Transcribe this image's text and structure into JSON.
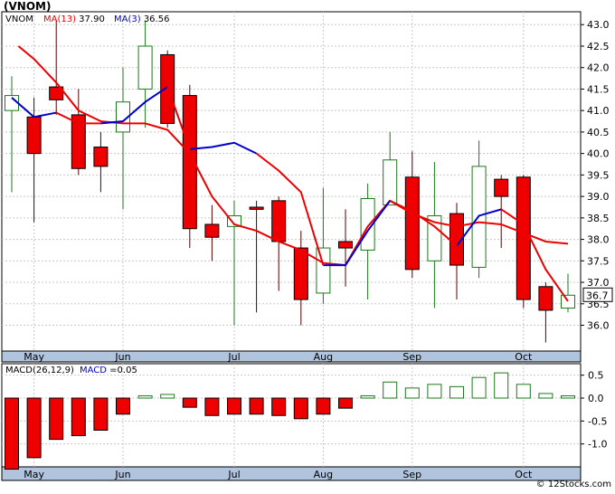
{
  "symbol": "(VNOM)",
  "footer": "© 12Stocks.com",
  "colors": {
    "up": "#1a7a1a",
    "down": "#ee0000",
    "ma13": "#ee0000",
    "ma3": "#0000cc",
    "panel_bg": "#ffffff",
    "axis_band": "#b0c4de",
    "grid": "#c8c8c8"
  },
  "chart_data": [
    {
      "type": "candlestick",
      "legend": [
        {
          "label": "VNOM",
          "value": ""
        },
        {
          "label": "MA(13)",
          "value": "37.90"
        },
        {
          "label": "MA(3)",
          "value": "36.56"
        }
      ],
      "ylim": [
        35.4,
        43.3
      ],
      "y_ticks": [
        36.0,
        36.5,
        37.0,
        37.5,
        38.0,
        38.5,
        39.0,
        39.5,
        40.0,
        40.5,
        41.0,
        41.5,
        42.0,
        42.5,
        43.0
      ],
      "y_tick_labels": [
        "36.0",
        "36.5",
        "37.0",
        "37.5",
        "38.0",
        "38.5",
        "39.0",
        "39.5",
        "40.0",
        "40.5",
        "41.0",
        "41.5",
        "42.0",
        "42.5",
        "43.0"
      ],
      "x_labels": [
        {
          "label": "May",
          "index": 1
        },
        {
          "label": "Jun",
          "index": 5
        },
        {
          "label": "Jul",
          "index": 10
        },
        {
          "label": "Aug",
          "index": 14
        },
        {
          "label": "Sep",
          "index": 18
        },
        {
          "label": "Oct",
          "index": 23
        }
      ],
      "last_price": "36.7",
      "candles": [
        {
          "o": 41.0,
          "h": 41.8,
          "l": 39.1,
          "c": 41.35
        },
        {
          "o": 40.85,
          "h": 41.3,
          "l": 38.4,
          "c": 40.0
        },
        {
          "o": 41.55,
          "h": 43.1,
          "l": 40.9,
          "c": 41.25
        },
        {
          "o": 40.9,
          "h": 41.5,
          "l": 39.5,
          "c": 39.65
        },
        {
          "o": 40.15,
          "h": 40.5,
          "l": 39.1,
          "c": 39.7
        },
        {
          "o": 40.5,
          "h": 42.0,
          "l": 38.7,
          "c": 41.2
        },
        {
          "o": 41.5,
          "h": 43.1,
          "l": 40.6,
          "c": 42.5
        },
        {
          "o": 42.3,
          "h": 42.4,
          "l": 40.6,
          "c": 40.7
        },
        {
          "o": 41.35,
          "h": 41.6,
          "l": 37.8,
          "c": 38.25
        },
        {
          "o": 38.35,
          "h": 38.8,
          "l": 37.5,
          "c": 38.05
        },
        {
          "o": 38.3,
          "h": 38.9,
          "l": 36.0,
          "c": 38.55
        },
        {
          "o": 38.75,
          "h": 38.9,
          "l": 36.3,
          "c": 38.7
        },
        {
          "o": 38.9,
          "h": 39.0,
          "l": 36.8,
          "c": 37.95
        },
        {
          "o": 37.8,
          "h": 38.2,
          "l": 36.0,
          "c": 36.6
        },
        {
          "o": 36.75,
          "h": 39.2,
          "l": 36.5,
          "c": 37.8
        },
        {
          "o": 37.95,
          "h": 38.7,
          "l": 36.9,
          "c": 37.8
        },
        {
          "o": 37.75,
          "h": 39.3,
          "l": 36.6,
          "c": 38.95
        },
        {
          "o": 38.8,
          "h": 40.5,
          "l": 38.8,
          "c": 39.85
        },
        {
          "o": 39.45,
          "h": 40.05,
          "l": 37.1,
          "c": 37.3
        },
        {
          "o": 37.5,
          "h": 39.8,
          "l": 36.4,
          "c": 38.55
        },
        {
          "o": 38.6,
          "h": 38.85,
          "l": 36.6,
          "c": 37.4
        },
        {
          "o": 37.35,
          "h": 40.3,
          "l": 37.1,
          "c": 39.7
        },
        {
          "o": 39.4,
          "h": 39.5,
          "l": 37.8,
          "c": 39.0
        },
        {
          "o": 39.45,
          "h": 39.5,
          "l": 36.4,
          "c": 36.6
        },
        {
          "o": 36.9,
          "h": 37.0,
          "l": 35.6,
          "c": 36.35
        },
        {
          "o": 36.4,
          "h": 37.2,
          "l": 36.3,
          "c": 36.7
        }
      ],
      "ma13": [
        {
          "i": 0.3,
          "v": 42.5
        },
        {
          "i": 1,
          "v": 42.2
        },
        {
          "i": 2,
          "v": 41.65
        },
        {
          "i": 3,
          "v": 41.0
        },
        {
          "i": 4,
          "v": 40.75
        },
        {
          "i": 5,
          "v": 40.7
        },
        {
          "i": 6,
          "v": 40.7
        },
        {
          "i": 7,
          "v": 40.55
        },
        {
          "i": 8,
          "v": 40.0
        },
        {
          "i": 9,
          "v": 39.0
        },
        {
          "i": 10,
          "v": 38.35
        },
        {
          "i": 11,
          "v": 38.2
        },
        {
          "i": 12,
          "v": 37.95
        },
        {
          "i": 13,
          "v": 37.75
        },
        {
          "i": 14,
          "v": 37.45
        },
        {
          "i": 15,
          "v": 37.4
        },
        {
          "i": 16,
          "v": 38.3
        },
        {
          "i": 17,
          "v": 38.9
        },
        {
          "i": 18,
          "v": 38.6
        },
        {
          "i": 19,
          "v": 38.4
        },
        {
          "i": 20,
          "v": 38.3
        },
        {
          "i": 21,
          "v": 38.4
        },
        {
          "i": 22,
          "v": 38.35
        },
        {
          "i": 23,
          "v": 38.15
        },
        {
          "i": 24,
          "v": 37.95
        },
        {
          "i": 25,
          "v": 37.9
        }
      ],
      "ma13_red_top": [
        {
          "i": 0.3,
          "v": 42.5
        },
        {
          "i": 1,
          "v": 42.2
        },
        {
          "i": 2,
          "v": 41.65
        },
        {
          "i": 3,
          "v": 41.0
        }
      ],
      "ma3_segments": [
        [
          {
            "i": 0,
            "v": 41.3
          },
          {
            "i": 1,
            "v": 40.85
          },
          {
            "i": 2,
            "v": 40.95
          }
        ],
        [
          {
            "i": 4,
            "v": 40.7
          },
          {
            "i": 5,
            "v": 40.75
          },
          {
            "i": 6,
            "v": 41.2
          },
          {
            "i": 7,
            "v": 41.55
          }
        ],
        [
          {
            "i": 8,
            "v": 40.1
          },
          {
            "i": 9,
            "v": 40.15
          },
          {
            "i": 10,
            "v": 40.25
          },
          {
            "i": 11,
            "v": 40.0
          }
        ],
        [
          {
            "i": 14,
            "v": 37.4
          },
          {
            "i": 15,
            "v": 37.4
          },
          {
            "i": 16,
            "v": 38.2
          },
          {
            "i": 17,
            "v": 38.9
          }
        ],
        [
          {
            "i": 20,
            "v": 37.85
          },
          {
            "i": 21,
            "v": 38.55
          },
          {
            "i": 22,
            "v": 38.7
          }
        ]
      ],
      "ma3_red_segments": [
        [
          {
            "i": 2,
            "v": 40.95
          },
          {
            "i": 3,
            "v": 40.7
          },
          {
            "i": 4,
            "v": 40.7
          }
        ],
        [
          {
            "i": 7,
            "v": 41.55
          },
          {
            "i": 8,
            "v": 40.1
          }
        ],
        [
          {
            "i": 11,
            "v": 40.0
          },
          {
            "i": 12,
            "v": 39.6
          },
          {
            "i": 13,
            "v": 39.1
          },
          {
            "i": 14,
            "v": 37.4
          }
        ],
        [
          {
            "i": 17,
            "v": 38.9
          },
          {
            "i": 18,
            "v": 38.65
          },
          {
            "i": 19,
            "v": 38.3
          },
          {
            "i": 20,
            "v": 37.85
          }
        ],
        [
          {
            "i": 22,
            "v": 38.7
          },
          {
            "i": 23,
            "v": 38.35
          },
          {
            "i": 24,
            "v": 37.3
          },
          {
            "i": 25,
            "v": 36.56
          }
        ]
      ]
    },
    {
      "type": "bar",
      "legend": [
        {
          "label": "MACD(26,12,9)",
          "value": ""
        },
        {
          "label": "MACD",
          "value": "0.05"
        }
      ],
      "ylim": [
        -1.5,
        0.75
      ],
      "y_ticks": [
        0.5,
        0.0,
        -0.5,
        -1.0
      ],
      "y_tick_labels": [
        "0.5",
        "0.0",
        "-0.5",
        "-1.0"
      ],
      "values": [
        -1.55,
        -1.3,
        -0.9,
        -0.82,
        -0.7,
        -0.35,
        0.05,
        0.08,
        -0.2,
        -0.38,
        -0.35,
        -0.35,
        -0.38,
        -0.45,
        -0.35,
        -0.22,
        0.05,
        0.35,
        0.22,
        0.3,
        0.25,
        0.45,
        0.55,
        0.3,
        0.1,
        0.05
      ],
      "x_labels": [
        {
          "label": "May",
          "index": 1
        },
        {
          "label": "Jun",
          "index": 5
        },
        {
          "label": "Jul",
          "index": 10
        },
        {
          "label": "Aug",
          "index": 14
        },
        {
          "label": "Sep",
          "index": 18
        },
        {
          "label": "Oct",
          "index": 23
        }
      ]
    }
  ]
}
